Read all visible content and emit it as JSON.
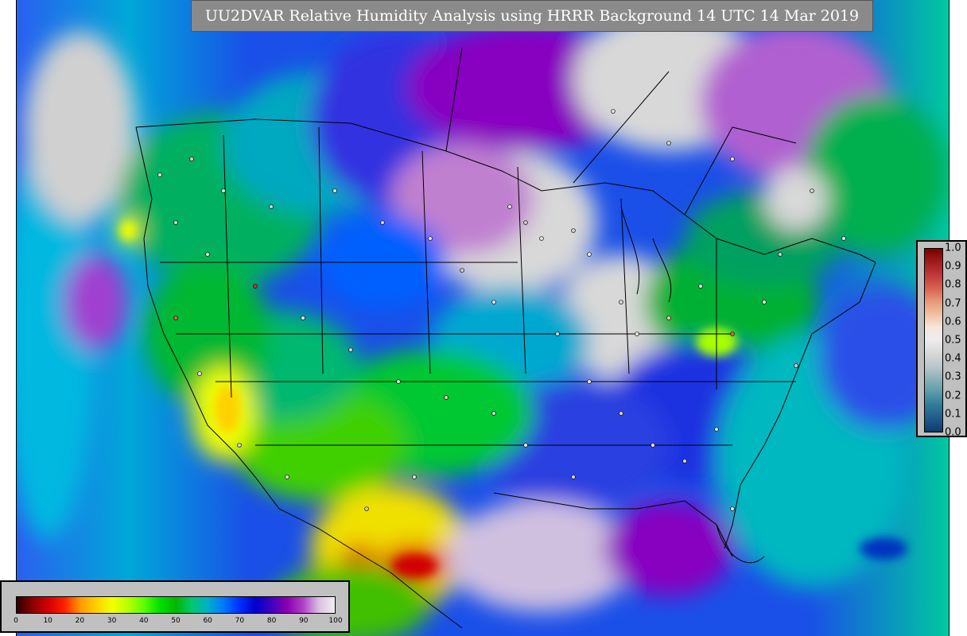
{
  "title": "UU2DVAR Relative Humidity Analysis using HRRR Background 14 UTC 14 Mar 2019",
  "rh_legend": {
    "ticks": [
      "0",
      "10",
      "20",
      "30",
      "40",
      "50",
      "60",
      "70",
      "80",
      "90",
      "100"
    ],
    "colors": [
      "#2b0000",
      "#8c0000",
      "#d40000",
      "#ff2000",
      "#ff9900",
      "#ffd000",
      "#f5ff00",
      "#b8ff00",
      "#5cff00",
      "#00e000",
      "#00b800",
      "#00c870",
      "#00b0c8",
      "#0078ff",
      "#0030ff",
      "#0000cc",
      "#4000c0",
      "#8800b0",
      "#b040c8",
      "#d8c0e0",
      "#f0f0f0"
    ]
  },
  "increment_legend": {
    "ticks": [
      "0.0",
      "0.1",
      "0.2",
      "0.3",
      "0.4",
      "0.5",
      "0.6",
      "0.7",
      "0.8",
      "0.9",
      "1.0"
    ],
    "colors": [
      "#0f3a6e",
      "#1f5b8a",
      "#2f7a99",
      "#5a9aa8",
      "#8ab0b8",
      "#b8c8cc",
      "#d8d8d8",
      "#ececec",
      "#f6e6dc",
      "#f0c0a0",
      "#e89878",
      "#d86050",
      "#c03838",
      "#a01c1c",
      "#7a0000"
    ]
  },
  "map": {
    "ocean_color": "#1a4fe8",
    "land_colors": [
      "#00a050",
      "#00c830",
      "#18b0c0",
      "#0060ff",
      "#3030e0",
      "#8800c0",
      "#a050c8",
      "#d8d8d8",
      "#f0ff00",
      "#ff9a00",
      "#e00000"
    ]
  }
}
